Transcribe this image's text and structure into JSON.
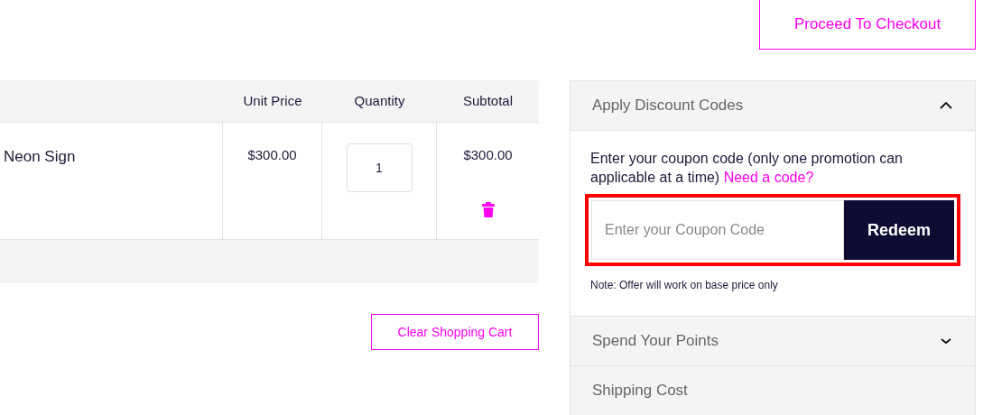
{
  "checkout_button": "Proceed To Checkout",
  "cart_table": {
    "columns": [
      "Unit Price",
      "Quantity",
      "Subtotal"
    ],
    "rows": [
      {
        "name": "Neon Sign",
        "unit_price": "$300.00",
        "quantity": "1",
        "subtotal": "$300.00"
      }
    ]
  },
  "clear_cart_button": "Clear Shopping Cart",
  "sections": [
    {
      "title": "Apply Discount Codes",
      "expanded": true,
      "body": {
        "text": "Enter your coupon code (only one promotion can applicable at a time)",
        "link": "Need a code?",
        "placeholder": "Enter your Coupon Code",
        "button": "Redeem",
        "note": "Note: Offer will work on base price only"
      }
    },
    {
      "title": "Spend Your Points",
      "expanded": false,
      "chevron": true
    },
    {
      "title": "Shipping Cost",
      "expanded": false,
      "chevron": false
    }
  ]
}
